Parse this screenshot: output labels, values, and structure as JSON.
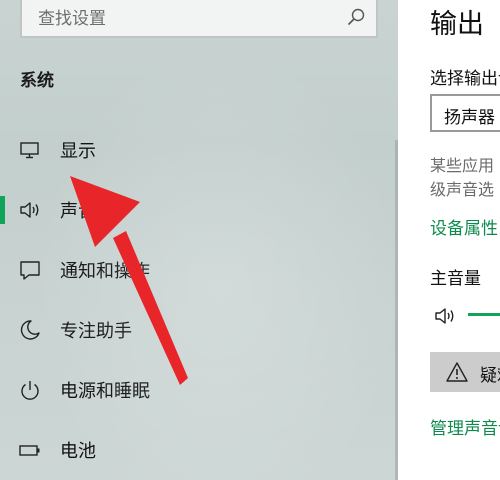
{
  "search": {
    "placeholder": "查找设置"
  },
  "nav": {
    "section_title": "系统",
    "items": [
      {
        "label": "显示",
        "icon": "monitor-icon"
      },
      {
        "label": "声音",
        "icon": "speaker-icon",
        "selected": true
      },
      {
        "label": "通知和操作",
        "icon": "notification-icon"
      },
      {
        "label": "专注助手",
        "icon": "moon-icon"
      },
      {
        "label": "电源和睡眠",
        "icon": "power-icon"
      },
      {
        "label": "电池",
        "icon": "battery-icon"
      }
    ]
  },
  "content": {
    "title": "输出",
    "output_label": "选择输出设备",
    "output_device": "扬声器",
    "desc_line1": "某些应用",
    "desc_line2": "级声音选",
    "device_properties_link": "设备属性",
    "master_volume_label": "主音量",
    "troubleshoot_label": "疑难解答",
    "manage_link": "管理声音设备"
  },
  "colors": {
    "accent": "#11a35a",
    "link": "#0f8a4e",
    "arrow": "#e8262a"
  }
}
